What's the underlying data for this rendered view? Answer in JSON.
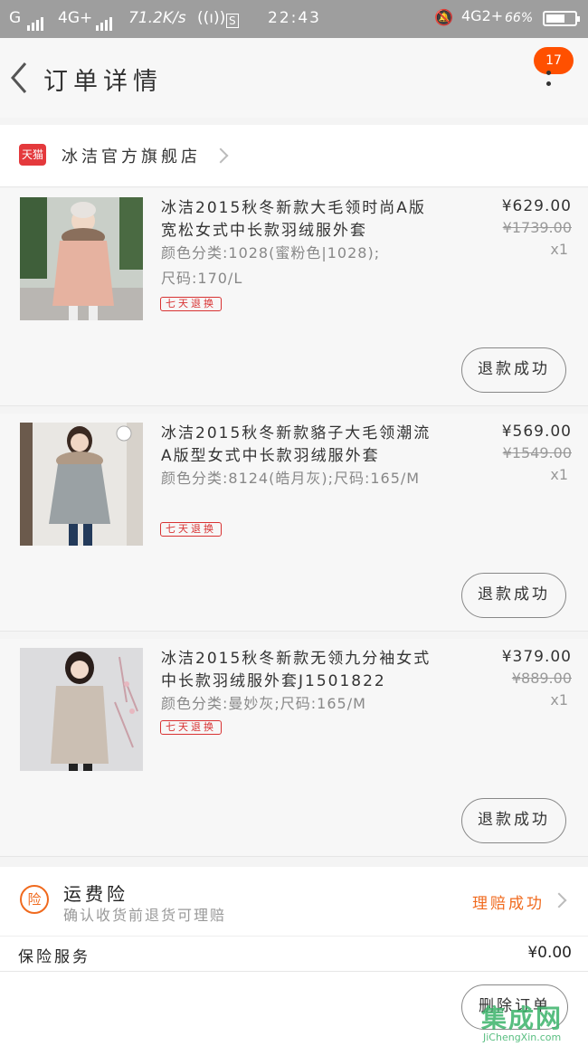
{
  "status_bar": {
    "carrier1": "G",
    "carrier2": "4G+",
    "speed": "71.2K/s",
    "s_label": "S",
    "time": "22:43",
    "net2": "4G2+",
    "battery_text": "66%",
    "battery_level": 0.66
  },
  "header": {
    "title": "订单详情",
    "badge": "17"
  },
  "shop": {
    "tmall_label": "天猫",
    "name": "冰洁官方旗舰店"
  },
  "items": [
    {
      "name": "冰洁2015秋冬新款大毛领时尚A版宽松女式中长款羽绒服外套",
      "sku": "颜色分类:1028(蜜粉色|1028);",
      "size": "尺码:170/L",
      "tag": "七天退换",
      "price": "¥629.00",
      "original_price": "¥1739.00",
      "qty": "x1",
      "action": "退款成功",
      "coat_color": "#e6b2a0"
    },
    {
      "name": "冰洁2015秋冬新款貉子大毛领潮流A版型女式中长款羽绒服外套",
      "sku": "颜色分类:8124(皓月灰);尺码:165/M",
      "size": "",
      "tag": "七天退换",
      "price": "¥569.00",
      "original_price": "¥1549.00",
      "qty": "x1",
      "action": "退款成功",
      "coat_color": "#9aa1a4"
    },
    {
      "name": "冰洁2015秋冬新款无领九分袖女式中长款羽绒服外套J1501822",
      "sku": "颜色分类:曼妙灰;尺码:165/M",
      "size": "",
      "tag": "七天退换",
      "price": "¥379.00",
      "original_price": "¥889.00",
      "qty": "x1",
      "action": "退款成功",
      "coat_color": "#cbbfb3"
    }
  ],
  "insurance": {
    "icon_char": "险",
    "title": "运费险",
    "subtitle": "确认收货前退货可理赔",
    "status": "理赔成功"
  },
  "service": {
    "label": "保险服务",
    "price": "¥0.00"
  },
  "bottom": {
    "delete_label": "删除订单"
  },
  "watermark": {
    "text": "集成网",
    "url": "JiChengXin.com"
  },
  "colors": {
    "accent": "#ff5000",
    "tmall_red": "#e4393c",
    "claim_orange": "#f06a1e"
  }
}
